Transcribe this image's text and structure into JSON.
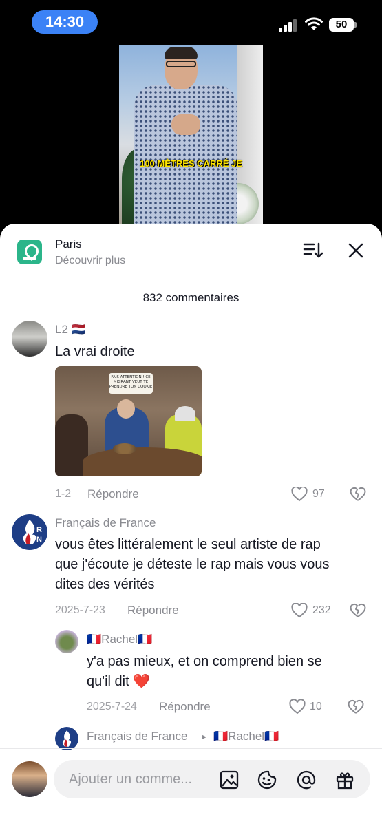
{
  "status_bar": {
    "time": "14:30",
    "battery": "50"
  },
  "video": {
    "caption": "100 MÈTRES CARRÉ JE"
  },
  "header": {
    "place_name": "Paris",
    "place_subtitle": "Découvrir plus"
  },
  "comments_count": "832 commentaires",
  "comments": [
    {
      "username": "L2 🇳🇱",
      "text": "La vrai droite",
      "meme_text": "FAIS ATTENTION ! CE MIGRANT VEUT TE PRENDRE TON COOKIE",
      "date": "1-2",
      "reply_label": "Répondre",
      "likes": "97"
    },
    {
      "username": "Français de France",
      "text_lines": [
        "vous êtes littéralement le seul artiste de rap",
        "que j'écoute je déteste le rap mais vous vous",
        "dites des vérités"
      ],
      "date": "2025-7-23",
      "reply_label": "Répondre",
      "likes": "232",
      "reply": {
        "username": "🇫🇷Rachel🇫🇷",
        "text_lines": [
          "y'a pas mieux, et on comprend bien se",
          "qu'il dit ❤️"
        ],
        "date": "2025-7-24",
        "reply_label": "Répondre",
        "likes": "10"
      },
      "next_reply_thread": {
        "from": "Français de France",
        "arrow": "▸",
        "to": "🇫🇷Rachel🇫🇷"
      }
    }
  ],
  "input": {
    "placeholder": "Ajouter un comme..."
  },
  "icons": {
    "like": "heart-icon",
    "dislike": "broken-heart-icon",
    "sort": "sort-icon",
    "close": "close-icon",
    "image": "image-icon",
    "emoji": "emoji-icon",
    "mention": "mention-icon",
    "gift": "gift-icon"
  },
  "colors": {
    "accent_time_pill": "#3b82f6",
    "place_icon": "#2bb58a",
    "text_primary": "#161823",
    "text_secondary": "#8a8b91"
  }
}
